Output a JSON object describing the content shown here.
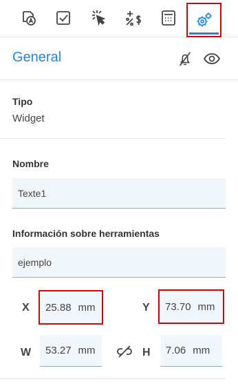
{
  "toolbar": {
    "tools": [
      {
        "name": "text-style-icon"
      },
      {
        "name": "checkbox-icon"
      },
      {
        "name": "click-action-icon"
      },
      {
        "name": "percent-currency-icon"
      },
      {
        "name": "calculator-icon"
      },
      {
        "name": "settings-gears-icon",
        "active": true
      }
    ],
    "accent": "#1e88e5",
    "highlight": "#d40000"
  },
  "section": {
    "title": "General"
  },
  "type": {
    "label": "Tipo",
    "value": "Widget"
  },
  "name": {
    "label": "Nombre",
    "value": "Texte1"
  },
  "tooltip": {
    "label": "Información sobre herramientas",
    "value": "ejemplo"
  },
  "geometry": {
    "x_label": "X",
    "x_value": "25.88",
    "y_label": "Y",
    "y_value": "73.70",
    "w_label": "W",
    "w_value": "53.27",
    "h_label": "H",
    "h_value": "7.06",
    "unit": "mm"
  }
}
